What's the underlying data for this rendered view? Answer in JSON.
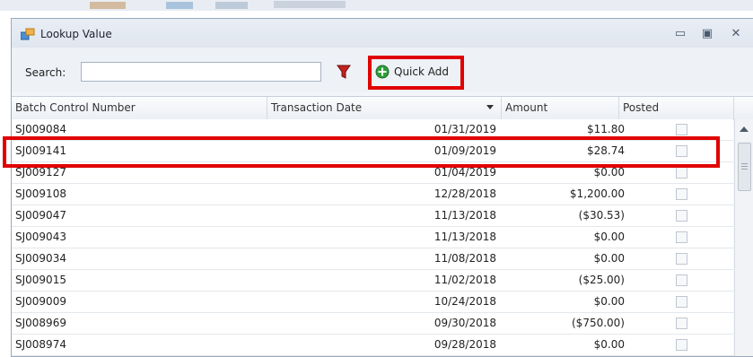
{
  "window": {
    "title": "Lookup Value"
  },
  "toolbar": {
    "search_label": "Search:",
    "search_value": "",
    "quick_add_label": "Quick Add"
  },
  "grid": {
    "columns": [
      "Batch Control Number",
      "Transaction Date",
      "Amount",
      "Posted"
    ],
    "rows": [
      {
        "batch": "SJ009084",
        "date": "01/31/2019",
        "amount": "$11.80",
        "posted": false
      },
      {
        "batch": "SJ009141",
        "date": "01/09/2019",
        "amount": "$28.74",
        "posted": false
      },
      {
        "batch": "SJ009127",
        "date": "01/04/2019",
        "amount": "$0.00",
        "posted": false
      },
      {
        "batch": "SJ009108",
        "date": "12/28/2018",
        "amount": "$1,200.00",
        "posted": false
      },
      {
        "batch": "SJ009047",
        "date": "11/13/2018",
        "amount": "($30.53)",
        "posted": false
      },
      {
        "batch": "SJ009043",
        "date": "11/13/2018",
        "amount": "$0.00",
        "posted": false
      },
      {
        "batch": "SJ009034",
        "date": "11/08/2018",
        "amount": "$0.00",
        "posted": false
      },
      {
        "batch": "SJ009015",
        "date": "11/02/2018",
        "amount": "($25.00)",
        "posted": false
      },
      {
        "batch": "SJ009009",
        "date": "10/24/2018",
        "amount": "$0.00",
        "posted": false
      },
      {
        "batch": "SJ008969",
        "date": "09/30/2018",
        "amount": "($750.00)",
        "posted": false
      },
      {
        "batch": "SJ008974",
        "date": "09/28/2018",
        "amount": "$0.00",
        "posted": false
      }
    ]
  },
  "colors": {
    "highlight": "#e00000",
    "window_border": "#9aaabd"
  }
}
